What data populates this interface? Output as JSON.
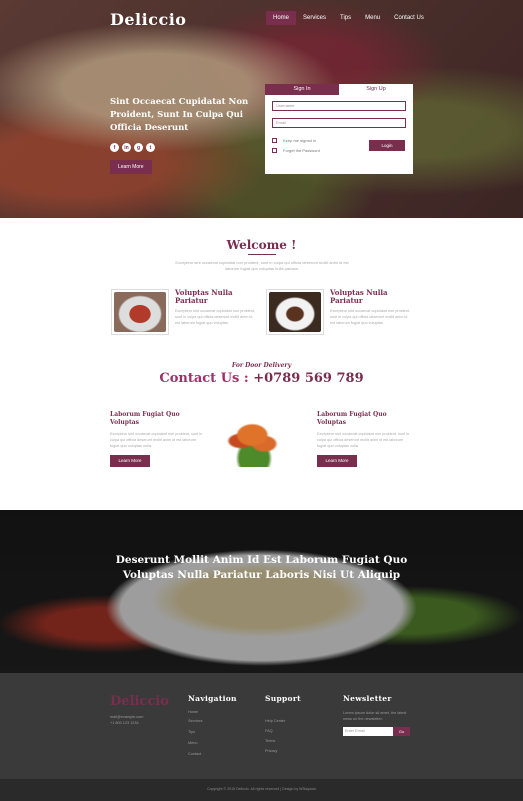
{
  "header": {
    "logo": "Deliccio",
    "nav": [
      "Home",
      "Services",
      "Tips",
      "Menu",
      "Contact Us"
    ]
  },
  "hero": {
    "headline": "Sint Occaecat Cupidatat Non Proident, Sunt In Culpa Qui Officia Deserunt",
    "social": [
      "f",
      "in",
      "g",
      "t"
    ],
    "button": "Learn More"
  },
  "login": {
    "tab_signin": "Sign In",
    "tab_signup": "Sign Up",
    "username_placeholder": "Username",
    "email_placeholder": "Email",
    "keep_signed_in": "Keep me signed in",
    "forgot_password": "Forget the Password",
    "login_button": "Login"
  },
  "welcome": {
    "title": "Welcome !",
    "text": "Excepteur sint occaecat cupidatat non proident, sunt in culpa qui officia deserunt mollit anim id est laborum fugiat quo voluptas nulla pariatur."
  },
  "features": [
    {
      "title": "Voluptas Nulla Pariatur",
      "text": "Excepteur sint occaecat cupidatat non proident, sunt in culpa qui officia deserunt mollit anim id est laborum fugiat quo voluptas."
    },
    {
      "title": "Voluptas Nulla Pariatur",
      "text": "Excepteur sint occaecat cupidatat non proident, sunt in culpa qui officia deserunt mollit anim id est laborum fugiat quo voluptas."
    }
  ],
  "contact": {
    "tagline": "For Door Delivery",
    "label": "Contact Us :",
    "phone": "+0789 569 789"
  },
  "columns": [
    {
      "title": "Laborum Fugiat Quo Voluptas",
      "text": "Excepteur sint occaecat cupidatat non proident, sunt in culpa qui officia deserunt mollit anim id est laborum fugiat quo voluptas nulla.",
      "button": "Learn More"
    },
    {
      "title": "Laborum Fugiat Quo Voluptas",
      "text": "Excepteur sint occaecat cupidatat non proident, sunt in culpa qui officia deserunt mollit anim id est laborum fugiat quo voluptas nulla.",
      "button": "Learn More"
    }
  ],
  "banner": {
    "text": "Deserunt Mollit Anim Id Est Laborum Fugiat Quo Voluptas Nulla Pariatur Laboris Nisi Ut Aliquip"
  },
  "footer": {
    "logo": "Deliccio",
    "info": [
      "mail@example.com",
      "+1 800 123 1234"
    ],
    "nav_head": "Navigation",
    "nav_links": [
      "Home",
      "Services",
      "Tips",
      "Menu",
      "Contact"
    ],
    "support_head": "Support",
    "support_links": [
      "Help Center",
      "FAQ",
      "Terms",
      "Privacy"
    ],
    "news_head": "Newsletter",
    "news_text": "Lorem ipsum dolor sit amet, the latest news on the newsletter.",
    "email_placeholder": "Enter Email",
    "go": "Go",
    "copyright": "Copyright © 2015 Deliccio. All rights reserved | Design by W3layouts"
  },
  "colors": {
    "accent": "#7a2e4e",
    "footer_bg": "#3a3a3a",
    "bottom_bar": "#2a2a2a"
  }
}
